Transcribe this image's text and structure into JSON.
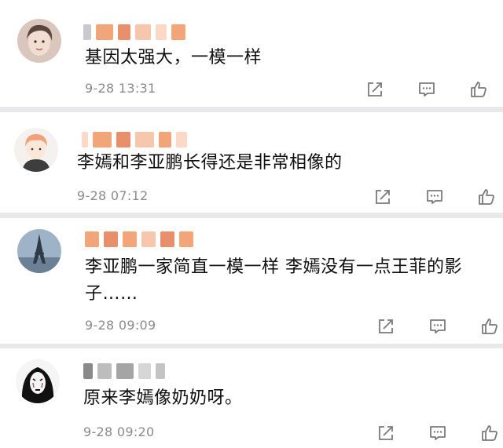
{
  "colors": {
    "page_background": "#e9e9ec",
    "card_background": "#ffffff",
    "timestamp": "#8a8a8a",
    "icon": "#7a7a7a",
    "name_blur": [
      "#f3a57a",
      "#f7c7ad",
      "#e8906b",
      "#fad9c6"
    ]
  },
  "comments": [
    {
      "avatar_icon": "woman-photo-avatar",
      "text": "基因太强大，一模一样",
      "time": "9-28 13:31"
    },
    {
      "avatar_icon": "cartoon-boy-avatar",
      "text": "李嫣和李亚鹏长得还是非常相像的",
      "time": "9-28 07:12"
    },
    {
      "avatar_icon": "eiffel-tower-avatar",
      "text_line1": "李亚鹏一家简直一模一样 李嫣没有一点王菲的影",
      "text_line2": "子……",
      "time": "9-28 09:09"
    },
    {
      "avatar_icon": "no-face-avatar",
      "text": "原来李嫣像奶奶呀。",
      "time": "9-28 09:20"
    }
  ],
  "action_icons": [
    "share-icon",
    "comment-icon",
    "like-icon"
  ]
}
